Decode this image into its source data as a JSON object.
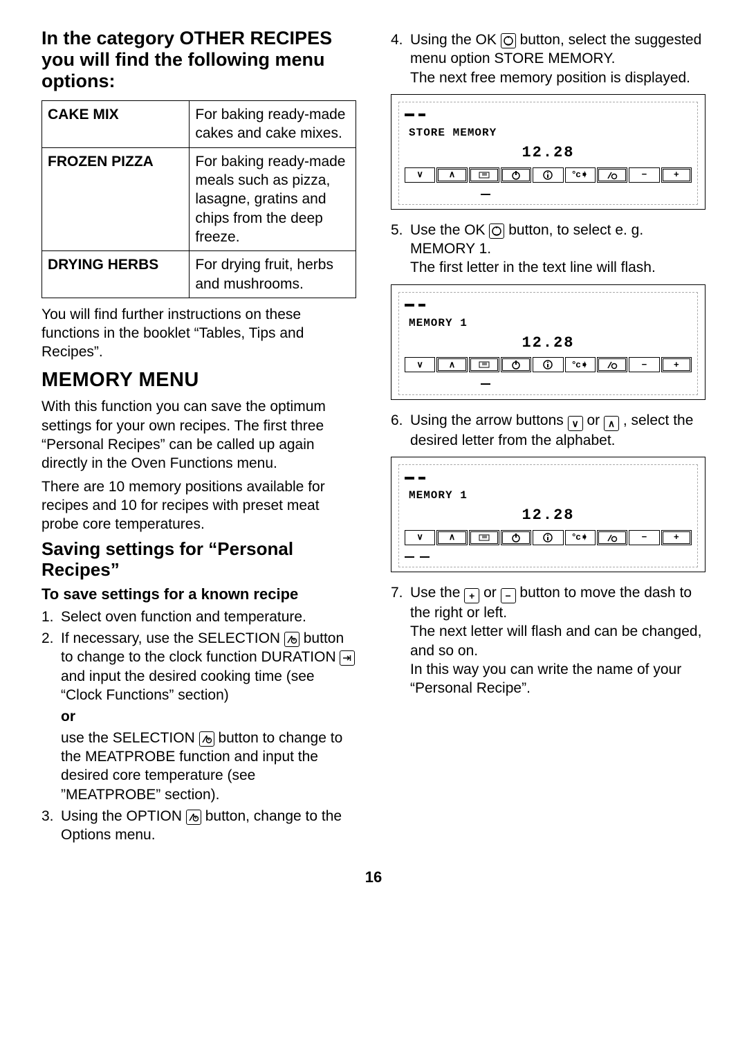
{
  "left": {
    "heading": "In the category OTHER RECIPES you will find the following menu options:",
    "table": {
      "rows": [
        {
          "label": "CAKE MIX",
          "desc": "For baking ready-made cakes and cake mixes."
        },
        {
          "label": "FROZEN PIZZA",
          "desc": "For baking ready-made meals such as pizza, lasagne, gratins and chips from the deep freeze."
        },
        {
          "label": "DRYING HERBS",
          "desc": "For drying fruit, herbs and mushrooms."
        }
      ]
    },
    "after_table": "You will find further instructions on these functions in the booklet “Tables, Tips and Recipes”.",
    "mem_heading": "MEMORY MENU",
    "mem_p1": "With this function you can save the optimum settings for your own recipes. The first three “Personal Recipes” can be called up again directly in the Oven Functions menu.",
    "mem_p2": "There are 10 memory positions available for recipes and 10 for recipes with preset meat probe core temperatures.",
    "save_heading": "Saving settings for “Personal Recipes”",
    "save_sub": "To save settings for a known recipe",
    "steps": {
      "s1": "Select oven function and temperature.",
      "s2a": "If necessary, use the SELECTION ",
      "s2b": " button to change to the clock function DURATION ",
      "s2c": " and input the desired cooking time (see “Clock Functions” section)",
      "or": "or",
      "s2alt_a": "use the SELECTION ",
      "s2alt_b": " button to change to the MEATPROBE function and input the desired core temperature (see ”MEATPROBE” section).",
      "s3a": "Using the OPTION ",
      "s3b": " button, change to the Options menu."
    }
  },
  "right": {
    "s4a": "Using the OK ",
    "s4b": " button, select the suggested menu option STORE MEMORY.",
    "s4c": "The next free memory position is displayed.",
    "lcd1": {
      "line1": "STORE MEMORY",
      "time": "12.28"
    },
    "s5a": "Use the OK ",
    "s5b": " button, to select e. g. MEMORY 1.",
    "s5c": "The first letter in the text line will flash.",
    "lcd2": {
      "line1": "MEMORY 1",
      "time": "12.28"
    },
    "s6a": "Using the arrow buttons ",
    "s6b": " or ",
    "s6c": " , select the desired letter from the alphabet.",
    "lcd3": {
      "line1": "MEMORY 1",
      "time": "12.28"
    },
    "s7a": "Use the ",
    "s7b": " or ",
    "s7c": " button to move the dash to the right or left.",
    "s7d": "The next letter will flash and can be changed, and so on.",
    "s7e": "In this way you can write the name of your “Personal Recipe”."
  },
  "page": "16",
  "icons": {
    "ok": "✓",
    "selection": "△⊙",
    "duration": "⇥",
    "down": "∨",
    "up": "∧",
    "plus": "+",
    "minus": "−"
  }
}
